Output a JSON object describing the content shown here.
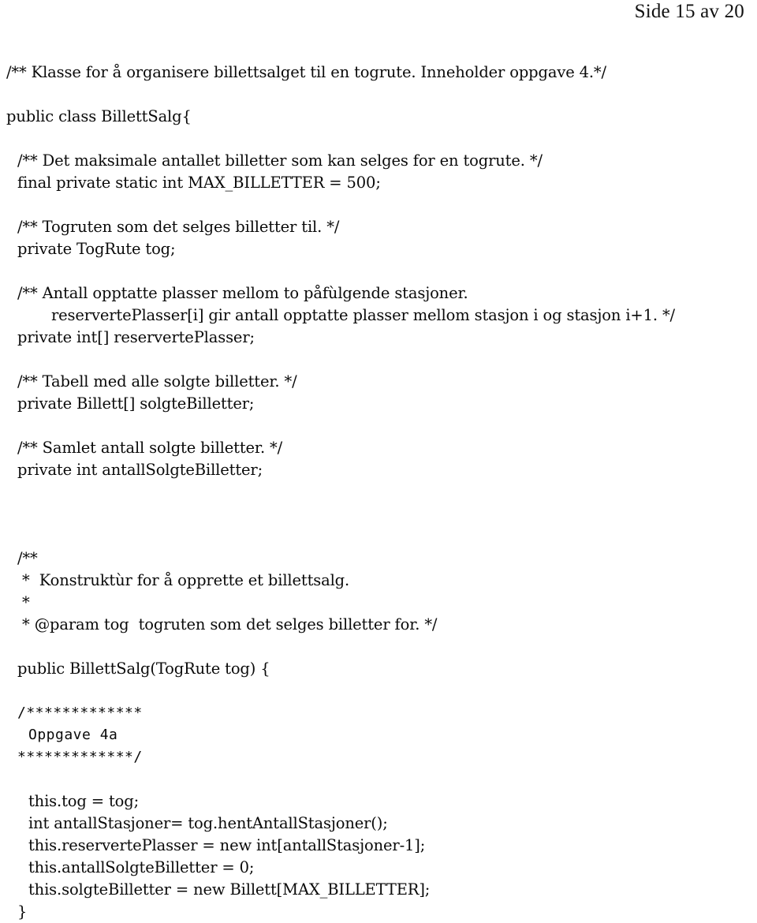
{
  "page": {
    "header": "Side 15 av 20",
    "page_number": 15,
    "page_total": 20,
    "background_color": "#ffffff",
    "text_color": "#000000"
  },
  "listing": {
    "language": "Java",
    "class_name": "BillettSalg",
    "lines": [
      {
        "id": "l01",
        "indent": "i0",
        "text": "/** Klasse for å organisere billettsalget til en togrute. Inneholder oppgave 4.*/"
      },
      {
        "id": "l02",
        "indent": "i0",
        "text": ""
      },
      {
        "id": "l03",
        "indent": "i0",
        "text": "public class BillettSalg{"
      },
      {
        "id": "l04",
        "indent": "i0",
        "text": ""
      },
      {
        "id": "l05",
        "indent": "i1",
        "text": "/** Det maksimale antallet billetter som kan selges for en togrute. */"
      },
      {
        "id": "l06",
        "indent": "i1",
        "text": "final private static int MAX_BILLETTER = 500;"
      },
      {
        "id": "l07",
        "indent": "i0",
        "text": ""
      },
      {
        "id": "l08",
        "indent": "i1",
        "text": "/** Togruten som det selges billetter til. */"
      },
      {
        "id": "l09",
        "indent": "i1",
        "text": "private TogRute tog;"
      },
      {
        "id": "l10",
        "indent": "i0",
        "text": ""
      },
      {
        "id": "l11",
        "indent": "i1",
        "text": "/** Antall opptatte plasser mellom to påfùlgende stasjoner."
      },
      {
        "id": "l12",
        "indent": "i4",
        "text": "reservertePlasser[i] gir antall opptatte plasser mellom stasjon i og stasjon i+1. */"
      },
      {
        "id": "l13",
        "indent": "i1",
        "text": "private int[] reservertePlasser;"
      },
      {
        "id": "l14",
        "indent": "i0",
        "text": ""
      },
      {
        "id": "l15",
        "indent": "i1",
        "text": "/** Tabell med alle solgte billetter. */"
      },
      {
        "id": "l16",
        "indent": "i1",
        "text": "private Billett[] solgteBilletter;"
      },
      {
        "id": "l17",
        "indent": "i0",
        "text": ""
      },
      {
        "id": "l18",
        "indent": "i1",
        "text": "/** Samlet antall solgte billetter. */"
      },
      {
        "id": "l19",
        "indent": "i1",
        "text": "private int antallSolgteBilletter;"
      },
      {
        "id": "l20",
        "indent": "i0",
        "text": ""
      },
      {
        "id": "l21",
        "indent": "i0",
        "text": ""
      },
      {
        "id": "l22",
        "indent": "i0",
        "text": ""
      },
      {
        "id": "l23",
        "indent": "i1",
        "text": "/**"
      },
      {
        "id": "l24",
        "indent": "i1",
        "text": " *  Konstruktùr for å opprette et billettsalg."
      },
      {
        "id": "l25",
        "indent": "i1",
        "text": " *"
      },
      {
        "id": "l26",
        "indent": "i1",
        "text": " * @param tog  togruten som det selges billetter for. */"
      },
      {
        "id": "l27",
        "indent": "i0",
        "text": ""
      },
      {
        "id": "l28",
        "indent": "i1",
        "text": "public BillettSalg(TogRute tog) {"
      },
      {
        "id": "l29",
        "indent": "i0",
        "text": ""
      },
      {
        "id": "l30",
        "indent": "i1",
        "text": "/*************",
        "mono": true
      },
      {
        "id": "l31",
        "indent": "i2",
        "text": "Oppgave 4a",
        "mono": true
      },
      {
        "id": "l32",
        "indent": "i1",
        "text": "*************/",
        "mono": true
      },
      {
        "id": "l33",
        "indent": "i0",
        "text": ""
      },
      {
        "id": "l34",
        "indent": "i2",
        "text": "this.tog = tog;"
      },
      {
        "id": "l35",
        "indent": "i2",
        "text": "int antallStasjoner= tog.hentAntallStasjoner();"
      },
      {
        "id": "l36",
        "indent": "i2",
        "text": "this.reservertePlasser = new int[antallStasjoner-1];"
      },
      {
        "id": "l37",
        "indent": "i2",
        "text": "this.antallSolgteBilletter = 0;"
      },
      {
        "id": "l38",
        "indent": "i2",
        "text": "this.solgteBilletter = new Billett[MAX_BILLETTER];"
      },
      {
        "id": "l39",
        "indent": "i1",
        "text": "}"
      }
    ]
  }
}
